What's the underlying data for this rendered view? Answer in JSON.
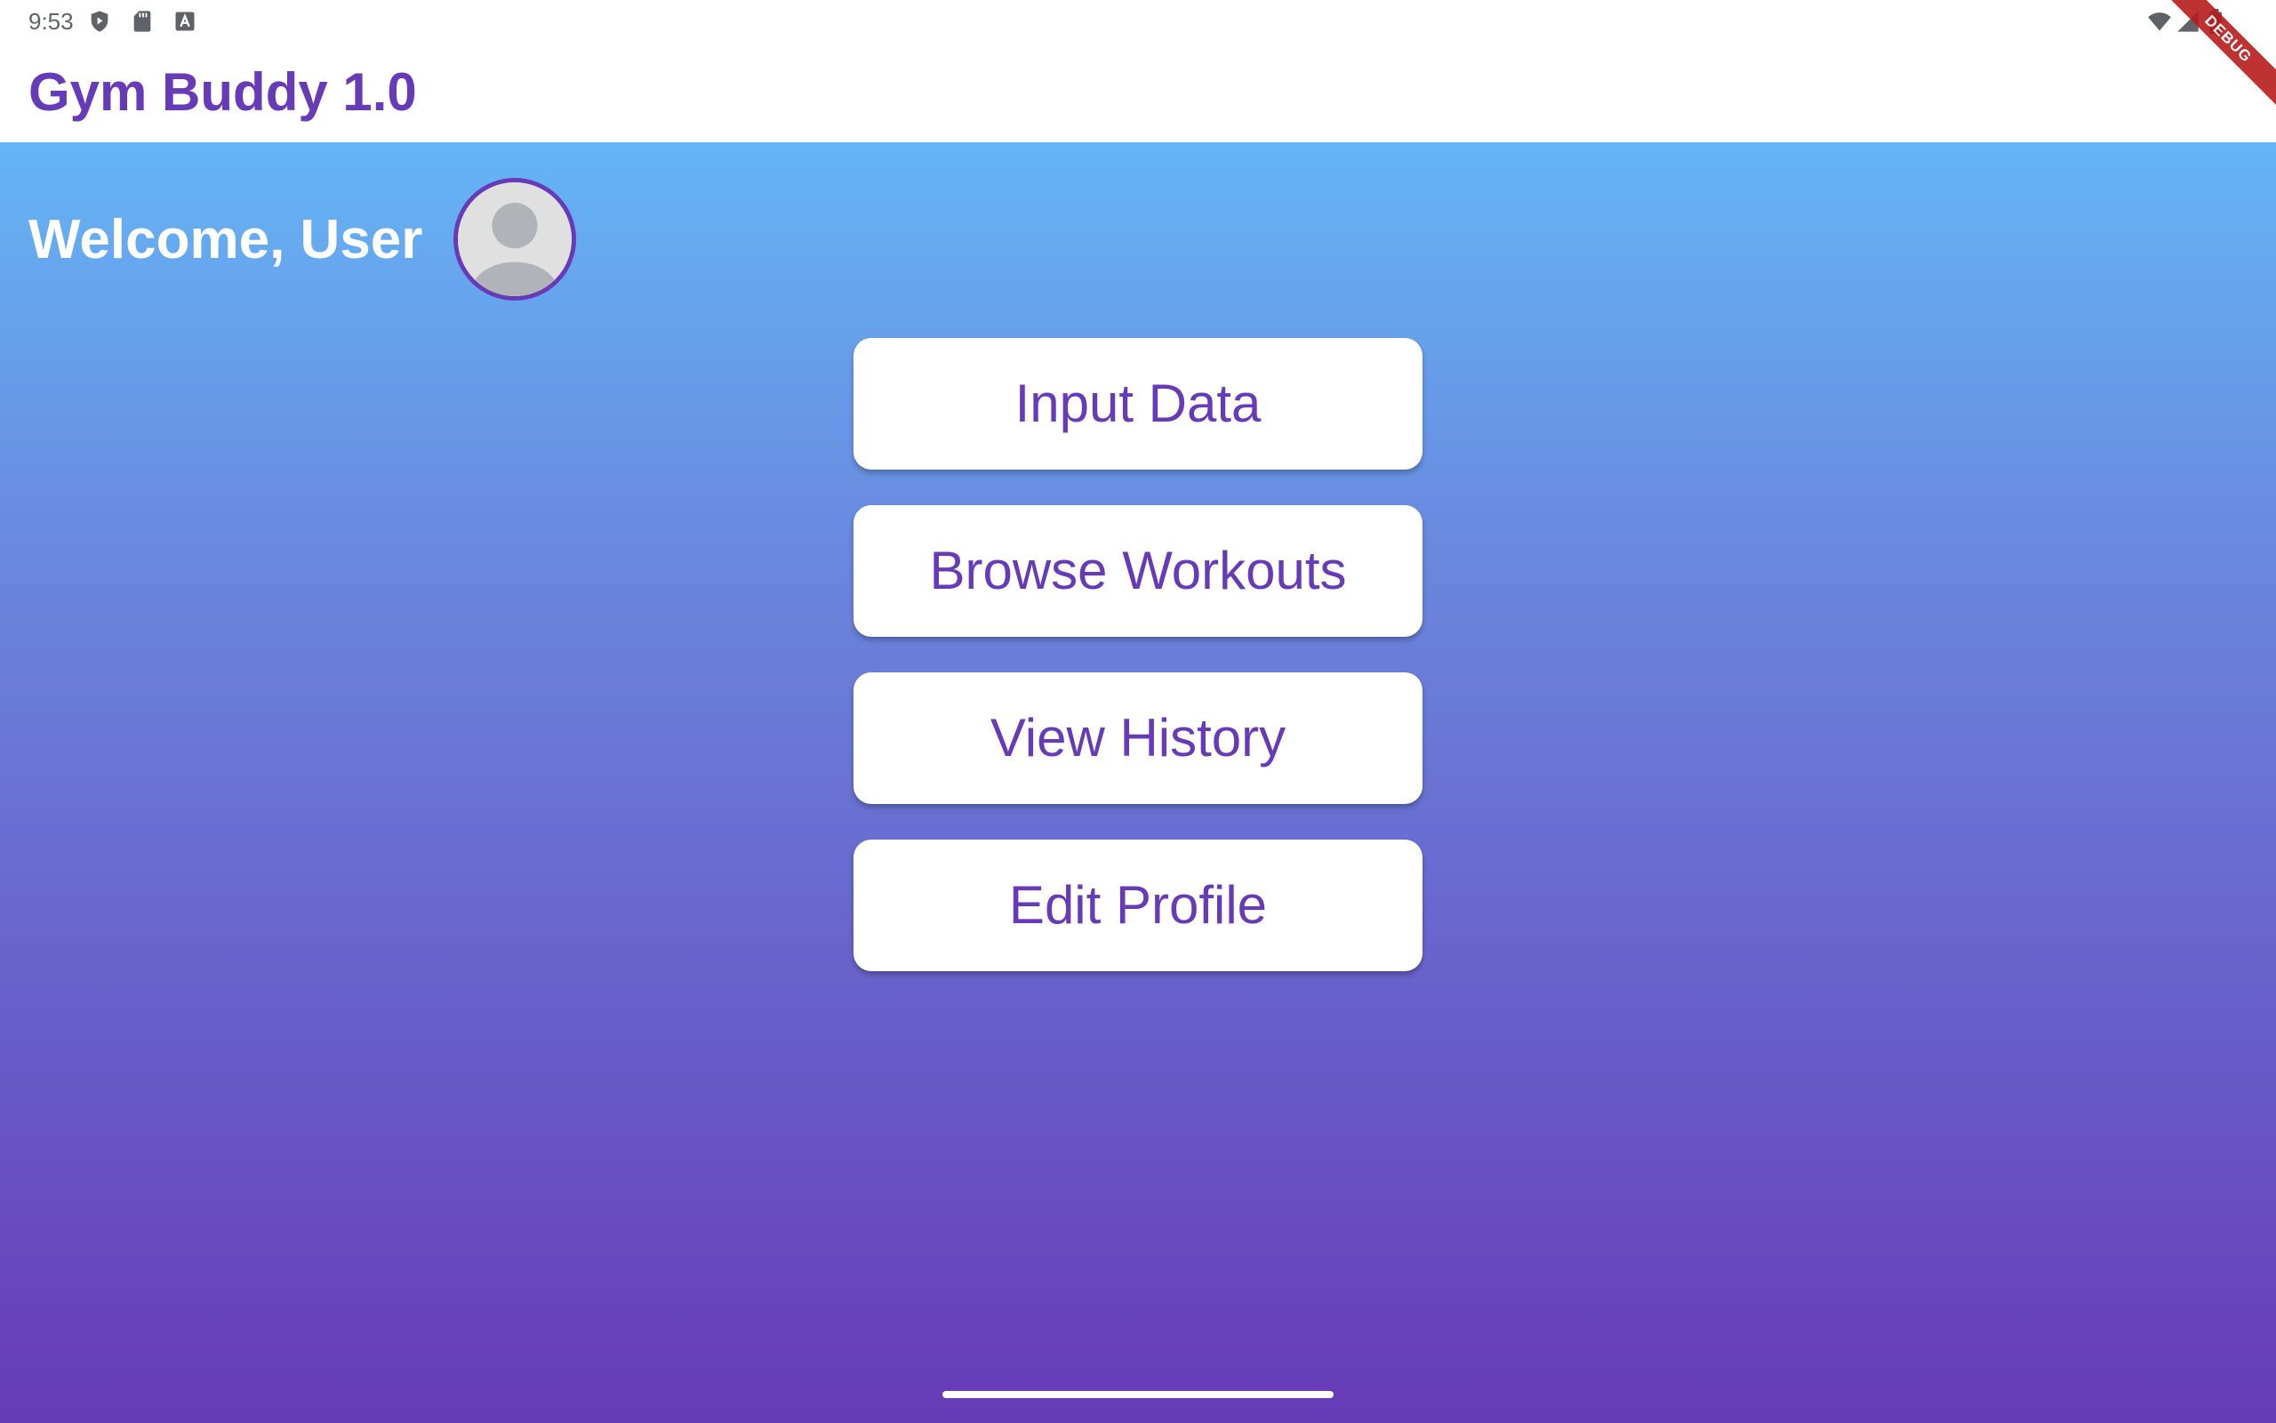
{
  "status_bar": {
    "time": "9:53",
    "icons_left": [
      "shield-play-icon",
      "sd-card-icon",
      "text-a-icon"
    ],
    "icons_right": [
      "wifi-icon",
      "signal-icon",
      "battery-icon"
    ]
  },
  "debug_banner": {
    "label": "DEBUG"
  },
  "app_bar": {
    "title": "Gym Buddy 1.0",
    "title_color": "#673ab7"
  },
  "home": {
    "welcome": "Welcome, User",
    "avatar_icon": "person-icon",
    "buttons": [
      {
        "label": "Input Data"
      },
      {
        "label": "Browse Workouts"
      },
      {
        "label": "View History"
      },
      {
        "label": "Edit Profile"
      }
    ]
  },
  "colors": {
    "accent": "#673ab7",
    "gradient_top": "#64b5f6",
    "gradient_bottom": "#673ab7"
  }
}
